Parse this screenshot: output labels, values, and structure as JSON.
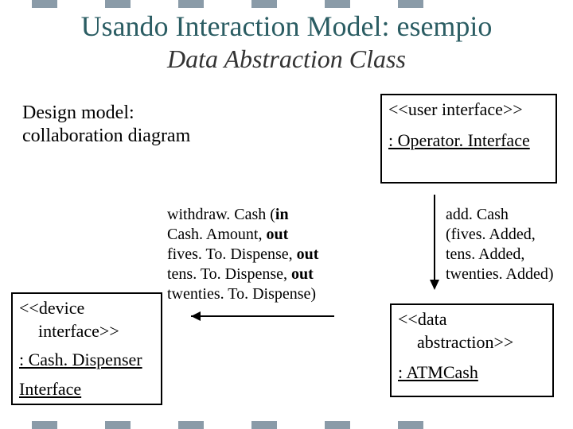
{
  "header": {
    "title": "Usando Interaction Model: esempio",
    "subtitle": "Data Abstraction Class"
  },
  "design_model": {
    "line1": "Design model:",
    "line2": "collaboration diagram"
  },
  "user_interface_box": {
    "stereotype": "<<user interface>>",
    "name": ": Operator. Interface"
  },
  "device_interface_box": {
    "stereotype": "<<device",
    "stereotype_line2": "interface>>",
    "name": ": Cash. Dispenser",
    "name_line2": "Interface"
  },
  "data_abstraction_box": {
    "stereotype": "<<data",
    "stereotype_line2": "abstraction>>",
    "name": ": ATMCash"
  },
  "msg_withdraw": "withdraw. Cash (in Cash. Amount, out fives. To. Dispense, out tens. To. Dispense, out twenties. To. Dispense)",
  "msg_add": "add. Cash (fives. Added, tens. Added, twenties. Added)"
}
